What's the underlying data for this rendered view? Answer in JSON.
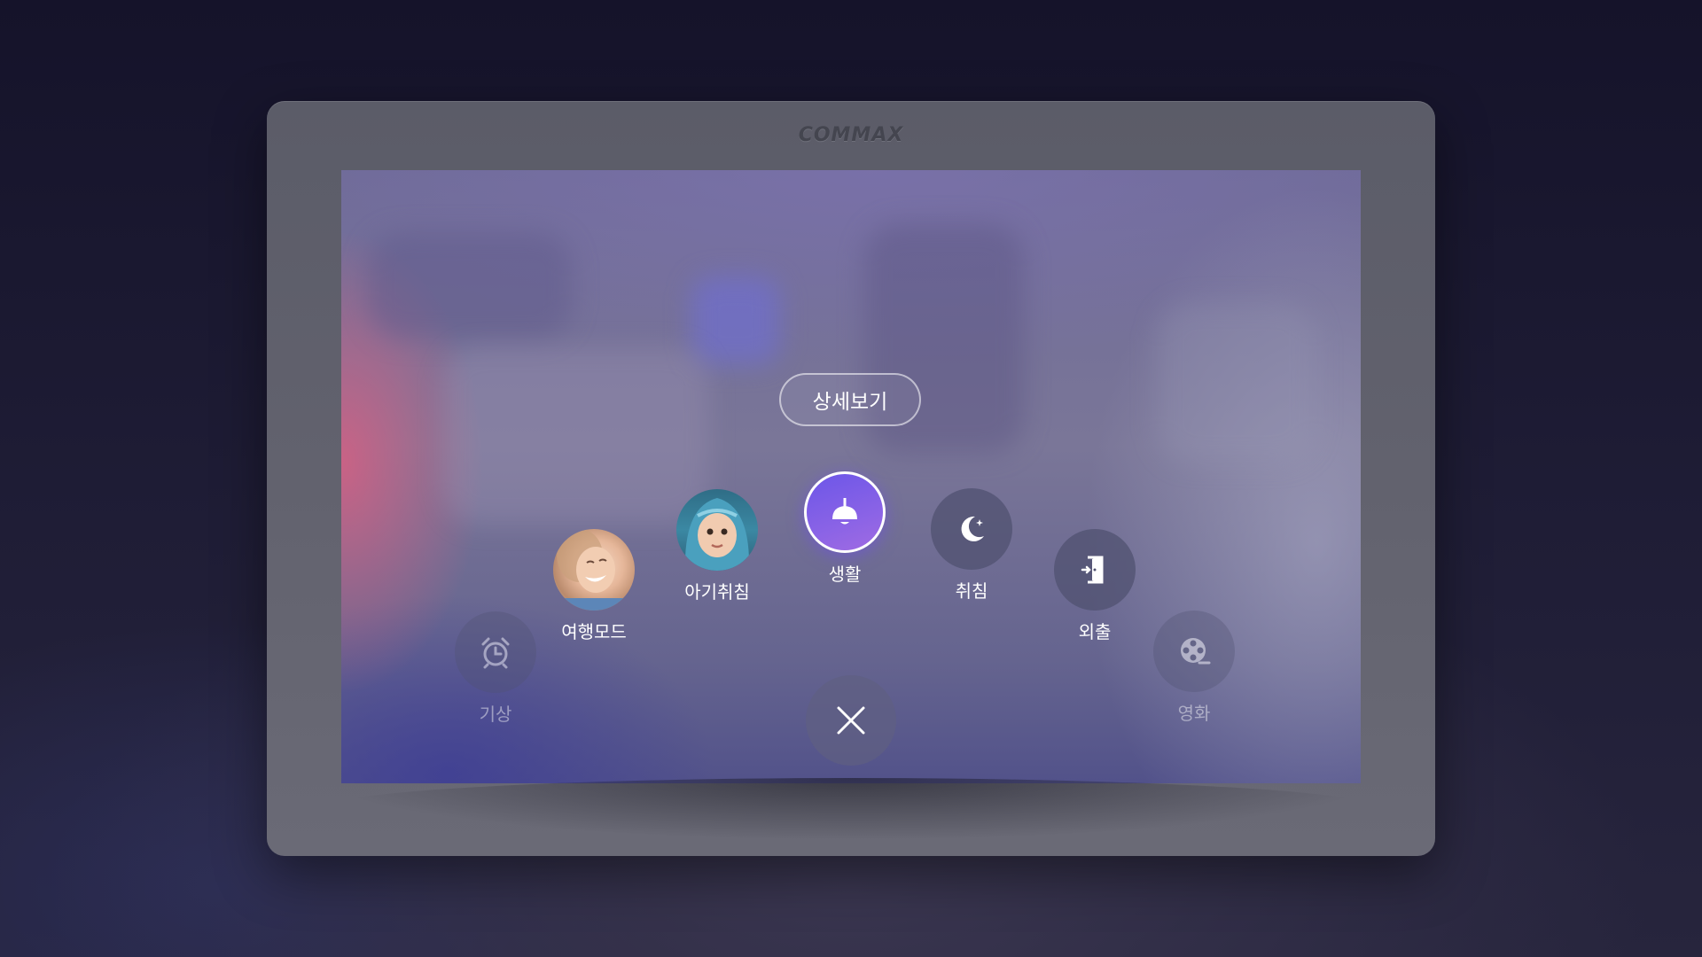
{
  "device": {
    "brand": "COMMAX"
  },
  "detail_button": {
    "label": "상세보기"
  },
  "modes": [
    {
      "id": "wake",
      "label": "기상",
      "icon": "alarm-clock-icon",
      "state": "faded"
    },
    {
      "id": "travel",
      "label": "여행모드",
      "icon": "photo-woman",
      "state": "normal"
    },
    {
      "id": "baby-sleep",
      "label": "아기취침",
      "icon": "photo-baby",
      "state": "normal"
    },
    {
      "id": "living",
      "label": "생활",
      "icon": "ceiling-lamp-icon",
      "state": "selected"
    },
    {
      "id": "sleep",
      "label": "취침",
      "icon": "moon-icon",
      "state": "normal"
    },
    {
      "id": "out",
      "label": "외출",
      "icon": "door-exit-icon",
      "state": "normal"
    },
    {
      "id": "movie",
      "label": "영화",
      "icon": "film-reel-icon",
      "state": "faded"
    }
  ],
  "close_button": {
    "icon": "close-icon"
  },
  "colors": {
    "accent": "#7b5ce6",
    "screen_overlay": "#6f6b98"
  }
}
